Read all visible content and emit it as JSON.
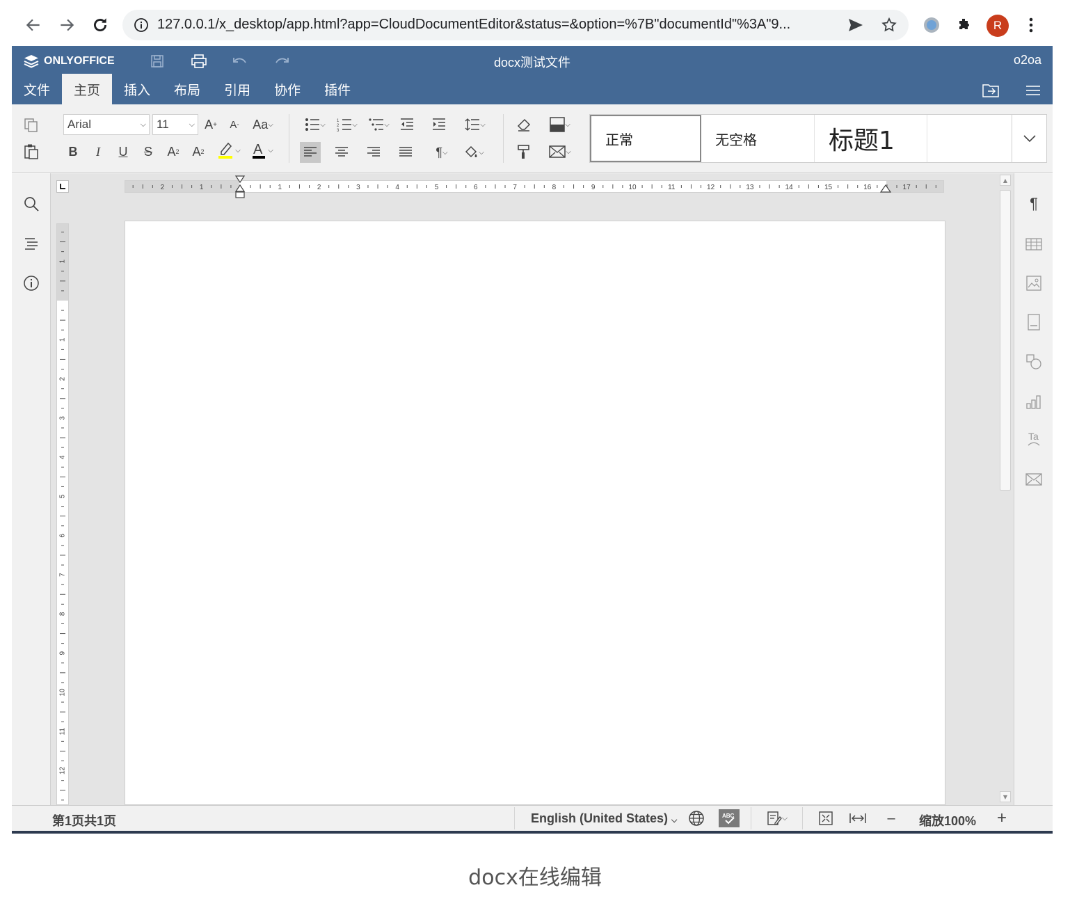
{
  "browser": {
    "url": "127.0.0.1/x_desktop/app.html?app=CloudDocumentEditor&status=&option=%7B\"documentId\"%3A\"9...",
    "avatar_letter": "R"
  },
  "app": {
    "logo_text": "ONLYOFFICE",
    "doc_title": "docx测试文件",
    "user": "o2oa",
    "tabs": [
      "文件",
      "主页",
      "插入",
      "布局",
      "引用",
      "协作",
      "插件"
    ],
    "active_tab": "主页"
  },
  "toolbar": {
    "font_name": "Arial",
    "font_size": "11",
    "styles": [
      "正常",
      "无空格",
      "标题1"
    ]
  },
  "statusbar": {
    "page_info": "第1页共1页",
    "language": "English (United States)",
    "zoom": "缩放100%"
  },
  "caption": "docx在线编辑",
  "colors": {
    "header": "#446995",
    "toolbar": "#f1f1f1",
    "highlight": "#ffff00"
  }
}
